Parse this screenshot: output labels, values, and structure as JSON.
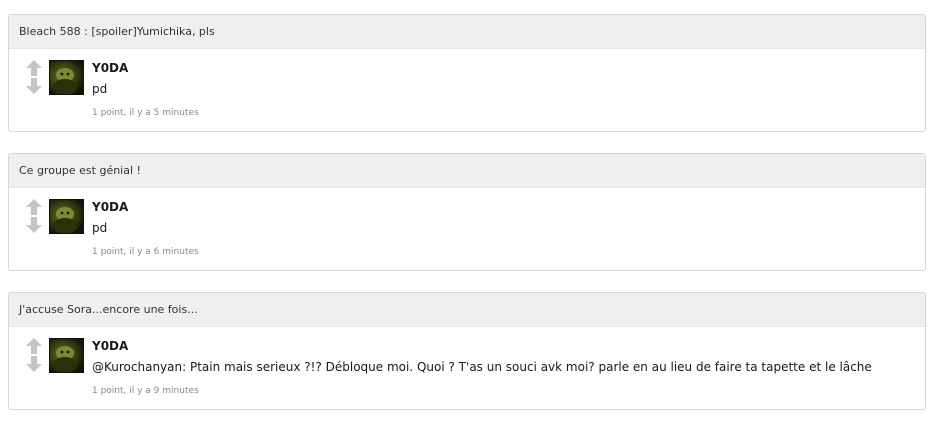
{
  "comments": [
    {
      "title": "Bleach 588 : [spoiler]Yumichika, pls",
      "author": "Y0DA",
      "message": "pd",
      "meta": "1 point, il y a 5 minutes"
    },
    {
      "title": "Ce groupe est génial !",
      "author": "Y0DA",
      "message": "pd",
      "meta": "1 point, il y a 6 minutes"
    },
    {
      "title": "J'accuse Sora...encore une fois...",
      "author": "Y0DA",
      "message": "@Kurochanyan: Ptain mais serieux ?!? Débloque moi. Quoi ? T'as un souci avk moi? parle en au lieu de faire ta tapette et le lâche",
      "meta": "1 point, il y a 9 minutes"
    }
  ],
  "icons": {
    "upvote": "arrow-up-icon",
    "downvote": "arrow-down-icon",
    "arrow_color": "#c4c4c4"
  }
}
